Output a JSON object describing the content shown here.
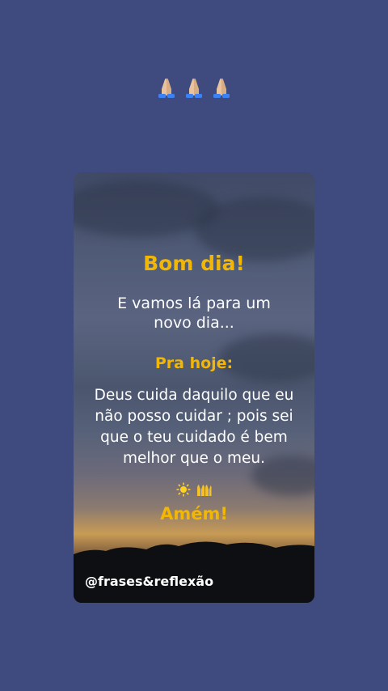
{
  "top_emojis": {
    "icons": [
      "folded-hands-icon",
      "folded-hands-icon",
      "folded-hands-icon"
    ]
  },
  "card": {
    "title": "Bom dia!",
    "subtitle_line1": "E vamos lá para um",
    "subtitle_line2": "novo dia...",
    "label": "Pra hoje:",
    "body_line1": "Deus cuida daquilo que eu",
    "body_line2": "não posso cuidar ; pois sei",
    "body_line3": "que o teu cuidado  é bem",
    "body_line4": "melhor que o meu.",
    "decor_icons": [
      "sun-icon",
      "raised-hands-icon"
    ],
    "closing": "Amém!",
    "handle": "@frases&reflexão"
  },
  "colors": {
    "background": "#3f4a7f",
    "accent_yellow": "#f2b705",
    "text_white": "#ffffff"
  }
}
